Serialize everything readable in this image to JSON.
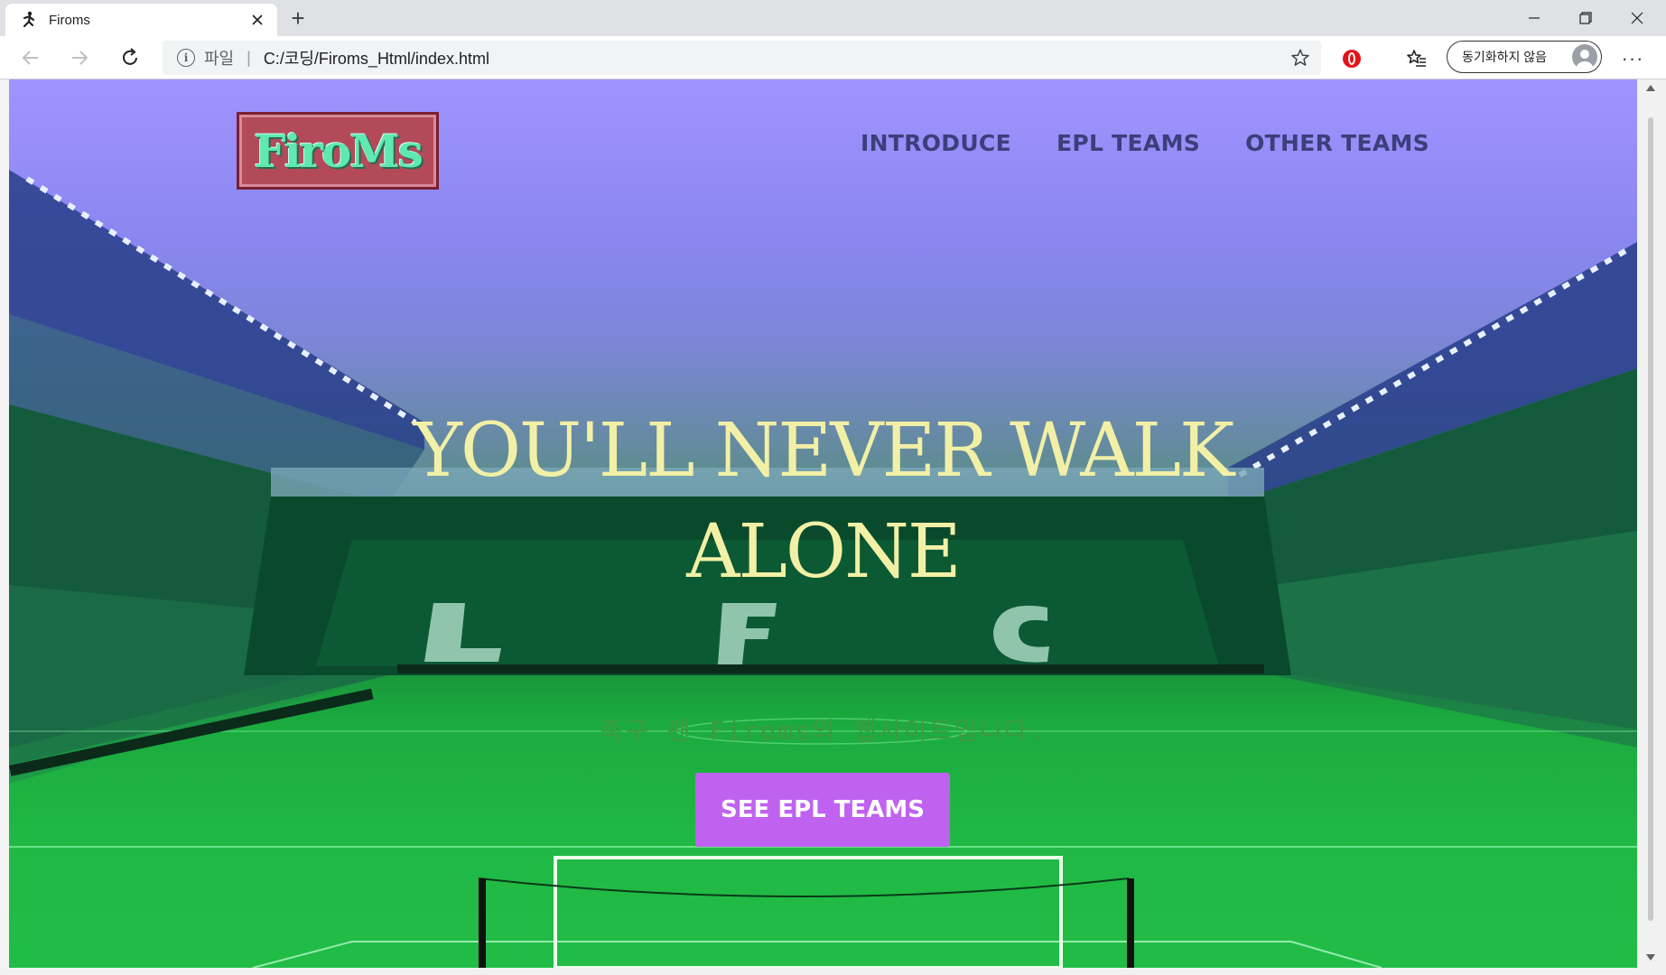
{
  "browser": {
    "tab_title": "Firoms",
    "tab_icon": "running-figure-icon",
    "new_tab_symbol": "+",
    "address": {
      "scheme_label": "파일",
      "separator": "|",
      "url": "C:/코딩/Firoms_Html/index.html"
    },
    "profile_label": "동기화하지 않음",
    "more_symbol": "···"
  },
  "site": {
    "logo_text": "FiroMs",
    "nav": [
      "INTRODUCE",
      "EPL TEAMS",
      "OTHER TEAMS"
    ],
    "hero": {
      "title_line1": "YOU'LL NEVER WALK",
      "title_line2": "ALONE",
      "subtitle": "축구 팬 Firoms의 웹사이트입니다.",
      "button_label": "SEE EPL TEAMS"
    }
  },
  "colors": {
    "hero_title": "#f2f0a6",
    "button_bg": "#c062f0",
    "nav_text": "#3b3f7a",
    "logo_bg": "#b34a5a",
    "logo_text": "#5fe8b0"
  }
}
